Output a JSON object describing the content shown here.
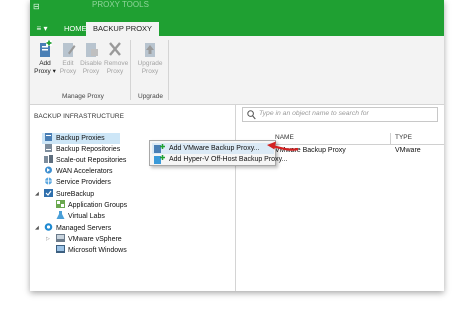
{
  "window": {
    "title_ghost": "PROXY TOOLS",
    "app_menu_label": "≡ ▾"
  },
  "tabs": [
    {
      "label": "HOME",
      "active": false
    },
    {
      "label": "BACKUP PROXY",
      "active": true
    }
  ],
  "ribbon": {
    "manage_proxy": {
      "buttons": [
        {
          "label_line1": "Add",
          "label_line2": "Proxy ▾",
          "enabled": true
        },
        {
          "label_line1": "Edit",
          "label_line2": "Proxy",
          "enabled": false
        },
        {
          "label_line1": "Disable",
          "label_line2": "Proxy",
          "enabled": false
        },
        {
          "label_line1": "Remove",
          "label_line2": "Proxy",
          "enabled": false
        }
      ],
      "group_label": "Manage Proxy"
    },
    "upgrade": {
      "buttons": [
        {
          "label_line1": "Upgrade",
          "label_line2": "Proxy",
          "enabled": false
        }
      ],
      "group_label": "Upgrade"
    }
  },
  "nav": {
    "header": "BACKUP INFRASTRUCTURE",
    "items": [
      {
        "label": "Backup Proxies",
        "selected": true
      },
      {
        "label": "Backup Repositories"
      },
      {
        "label": "Scale-out Repositories"
      },
      {
        "label": "WAN Accelerators"
      },
      {
        "label": "Service Providers"
      },
      {
        "label": "SureBackup"
      },
      {
        "label": "Application Groups"
      },
      {
        "label": "Virtual Labs"
      },
      {
        "label": "Managed Servers"
      },
      {
        "label": "VMware vSphere"
      },
      {
        "label": "Microsoft Windows"
      }
    ]
  },
  "search": {
    "placeholder": "Type in an object name to search for"
  },
  "table": {
    "columns": [
      "NAME",
      "TYPE"
    ],
    "rows": [
      {
        "name": "VMware Backup Proxy",
        "type": "VMware"
      }
    ]
  },
  "context_menu": {
    "items": [
      {
        "label": "Add VMware Backup Proxy...",
        "highlighted": true
      },
      {
        "label": "Add Hyper-V Off-Host Backup Proxy..."
      }
    ]
  },
  "colors": {
    "accent_green": "#1fa032",
    "annotation_red": "#d32222",
    "selection_blue": "#cde6f7"
  }
}
